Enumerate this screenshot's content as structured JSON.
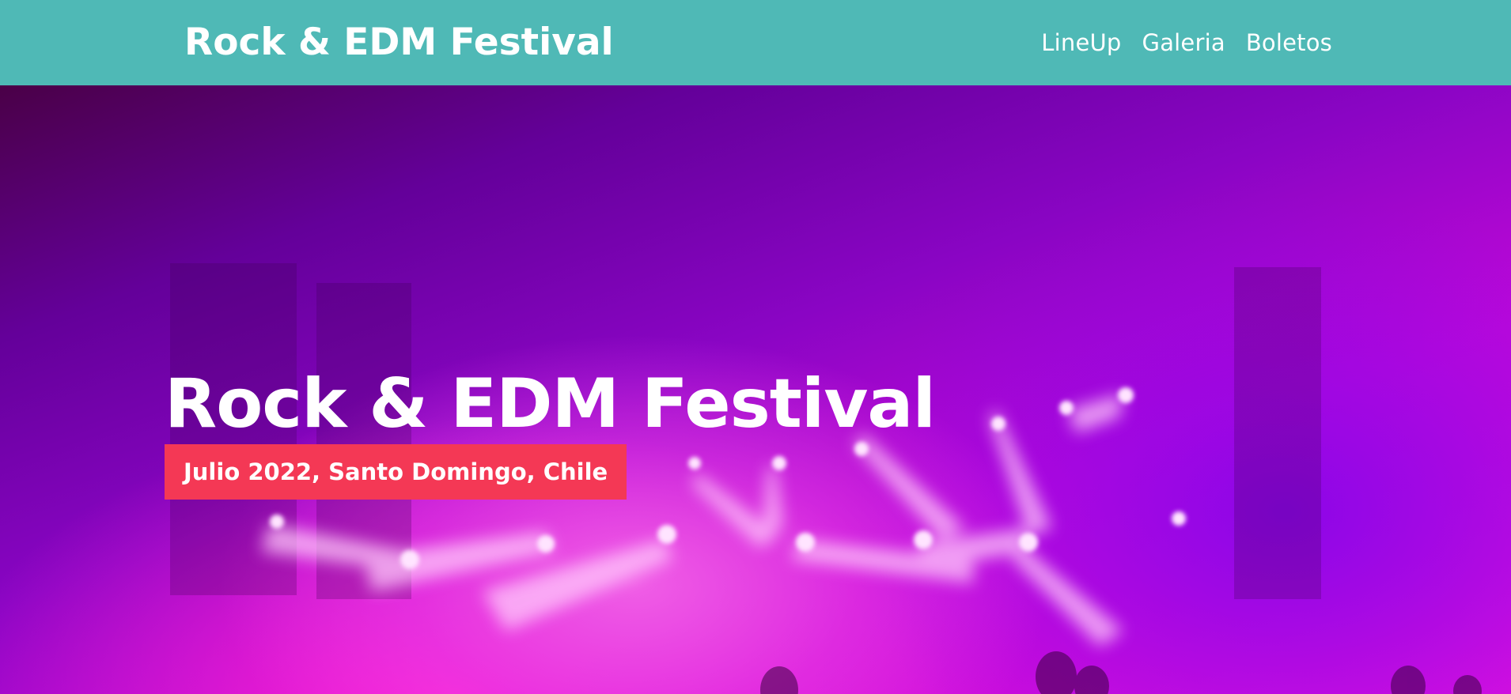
{
  "header": {
    "site_title": "Rock & EDM Festival",
    "nav": [
      {
        "label": "LineUp"
      },
      {
        "label": "Galeria"
      },
      {
        "label": "Boletos"
      }
    ]
  },
  "hero": {
    "title": "Rock & EDM Festival",
    "subtitle": "Julio 2022, Santo Domingo, Chile"
  },
  "colors": {
    "header_bg": "#4fb9b6",
    "badge_bg": "#f43855",
    "hero_tint_purple": "#7a04c8",
    "hero_tint_magenta": "#ff24d4",
    "text": "#ffffff"
  }
}
